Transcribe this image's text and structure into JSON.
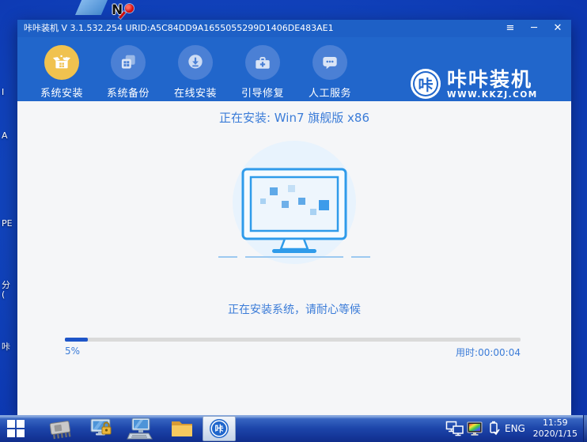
{
  "desktop": {
    "edge_labels": [
      "I",
      "A",
      "PE",
      "分",
      "(",
      "咔"
    ]
  },
  "window": {
    "title": "咔咔装机 V 3.1.532.254 URID:A5C84DD9A1655055299D1406DE483AE1",
    "controls": {
      "menu": "≡",
      "minimize": "─",
      "close": "✕"
    },
    "nav_items": [
      {
        "label": "系统安装"
      },
      {
        "label": "系统备份"
      },
      {
        "label": "在线安装"
      },
      {
        "label": "引导修复"
      },
      {
        "label": "人工服务"
      }
    ],
    "logo": {
      "badge": "咔",
      "name": "咔咔装机",
      "site": "WWW.KKZJ.COM"
    },
    "main": {
      "installing_title": "正在安装: Win7 旗舰版 x86",
      "status_text": "正在安装系统，请耐心等候",
      "progress_percent_label": "5%",
      "progress_value": 5,
      "elapsed_label": "用时:00:00:04"
    }
  },
  "taskbar": {
    "language": "ENG",
    "time": "11:59",
    "date": "2020/1/15",
    "kaka_badge": "咔"
  },
  "colors": {
    "window_header": "#2166CB",
    "active_icon_circle": "#F0C24F",
    "inactive_icon_circle": "#4B80D5",
    "accent_text": "#3B7CD8",
    "progress_fill": "#1E55C8"
  }
}
